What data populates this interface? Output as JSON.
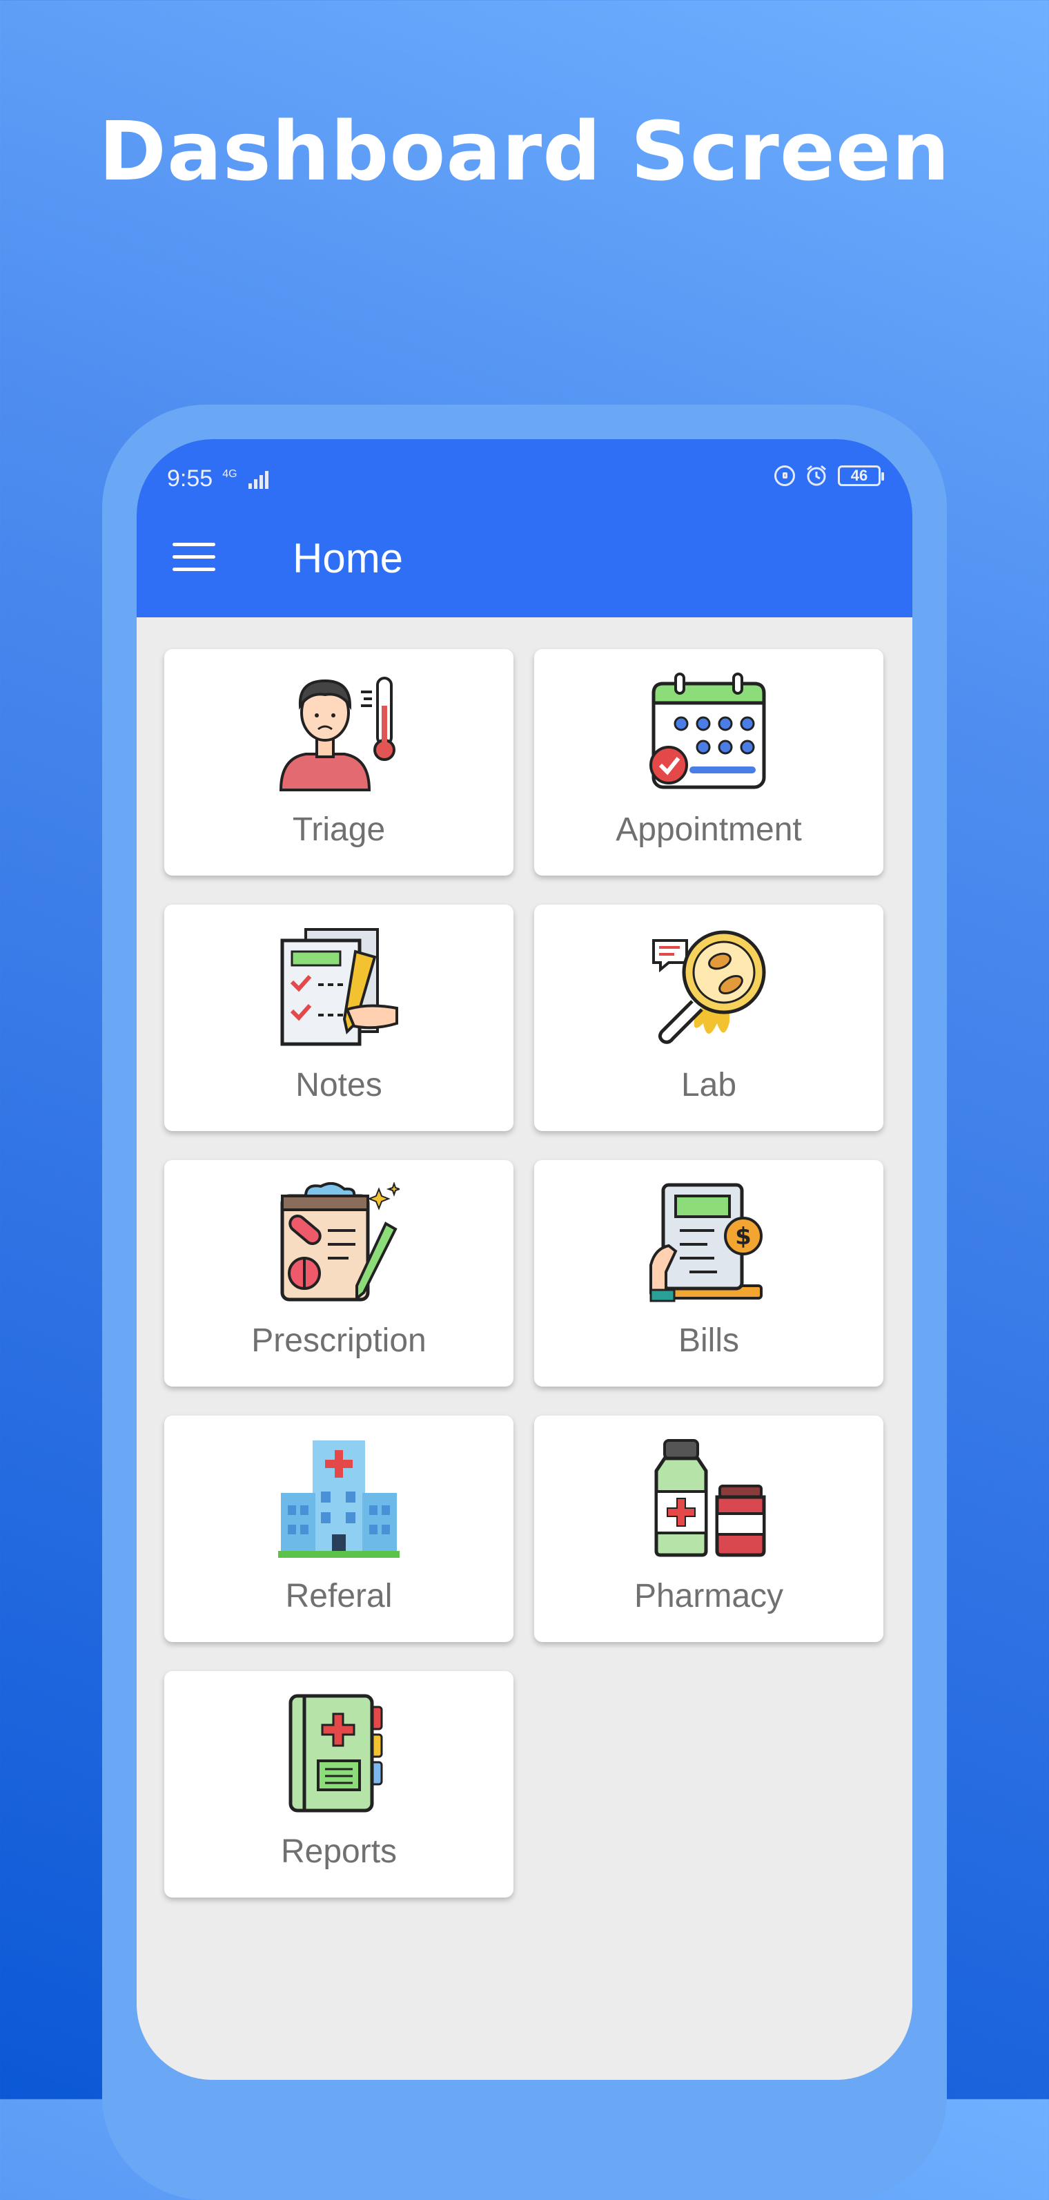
{
  "headline": "Dashboard Screen",
  "status_bar": {
    "time": "9:55",
    "network": "4G",
    "battery": "46"
  },
  "app_bar": {
    "title": "Home",
    "color": "#2e6ff5"
  },
  "menu_items": [
    {
      "label": "Triage",
      "icon": "patient-thermometer-icon"
    },
    {
      "label": "Appointment",
      "icon": "calendar-icon"
    },
    {
      "label": "Notes",
      "icon": "clipboard-notes-icon"
    },
    {
      "label": "Lab",
      "icon": "microscope-lens-icon"
    },
    {
      "label": "Prescription",
      "icon": "prescription-icon"
    },
    {
      "label": "Bills",
      "icon": "bill-receipt-icon"
    },
    {
      "label": "Referal",
      "icon": "hospital-building-icon"
    },
    {
      "label": "Pharmacy",
      "icon": "medicine-bottles-icon"
    },
    {
      "label": "Reports",
      "icon": "medical-book-icon"
    }
  ]
}
